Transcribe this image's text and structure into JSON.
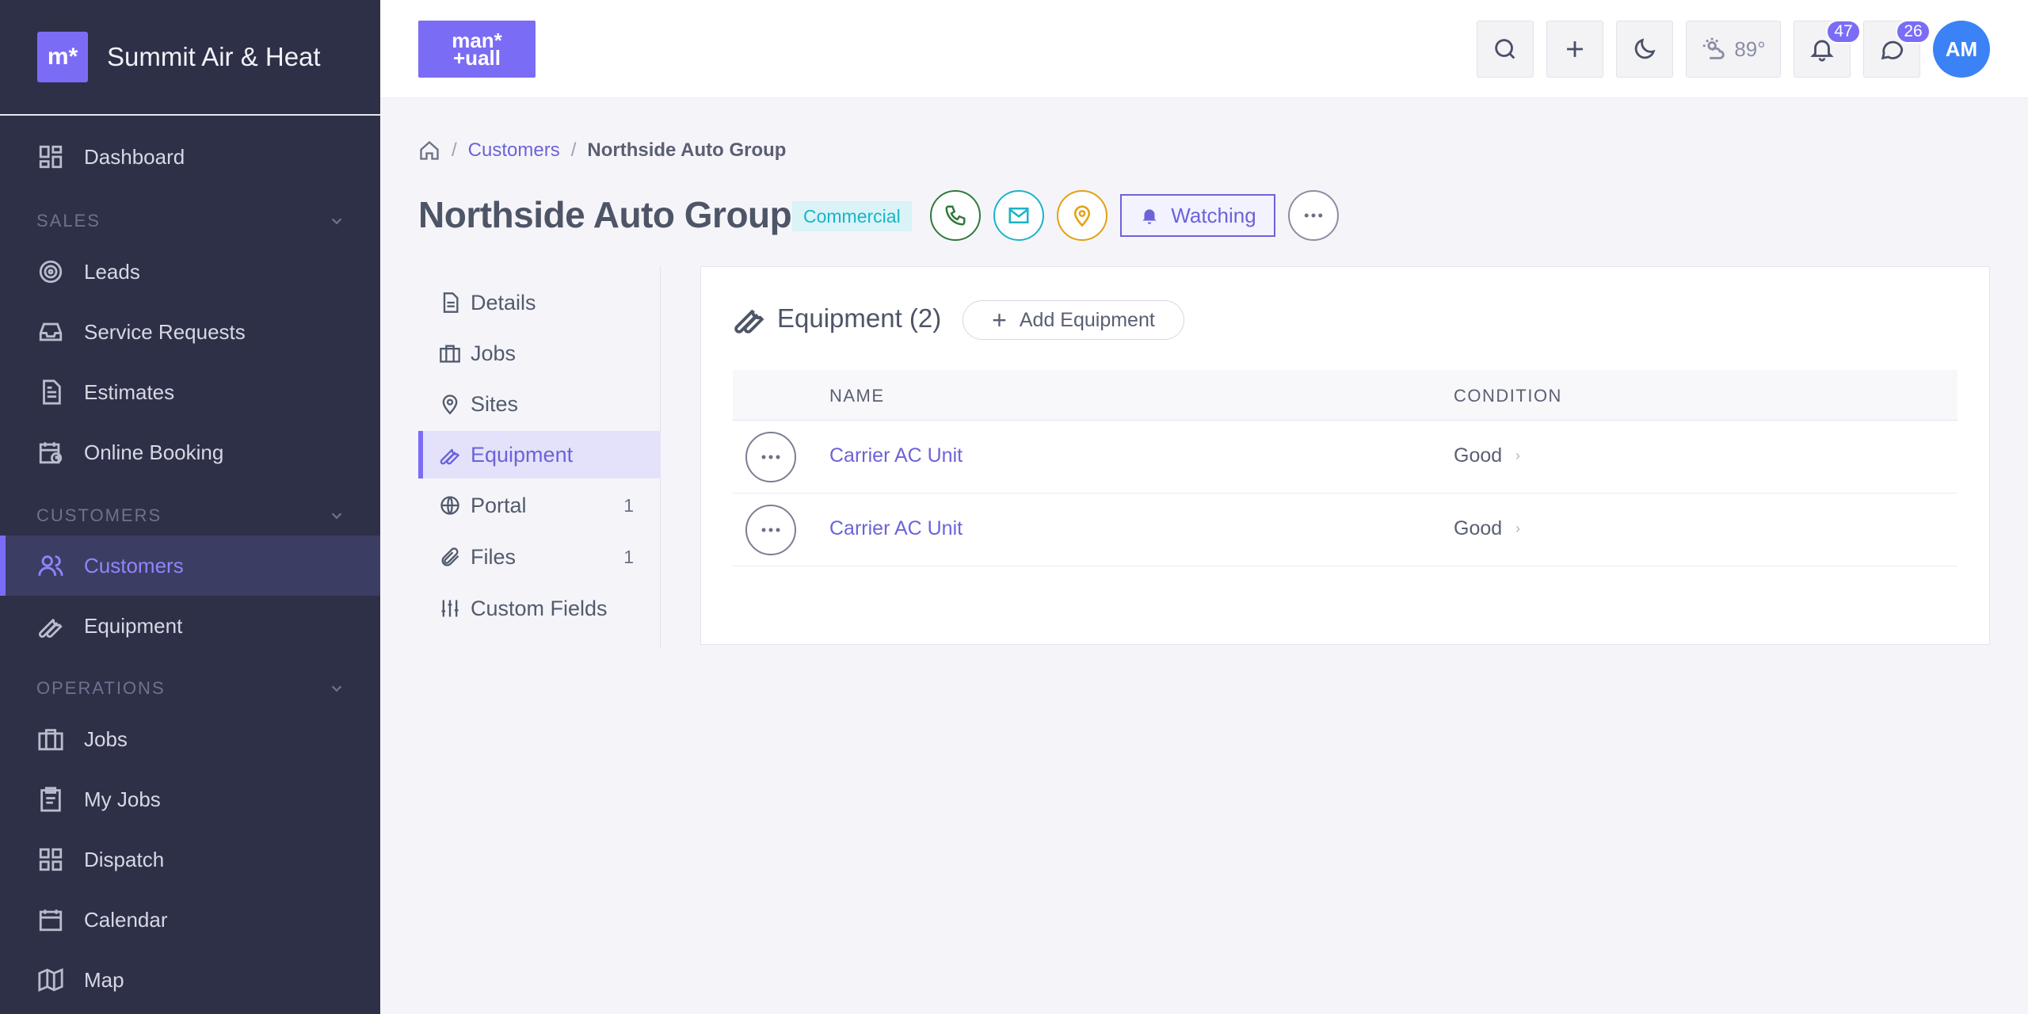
{
  "app": {
    "name": "Summit Air & Heat",
    "logo_text": "m*"
  },
  "top_logo_lines": [
    "man*",
    "+uall"
  ],
  "topbar": {
    "weather": "89°",
    "notifications_count": "47",
    "messages_count": "26",
    "avatar_initials": "AM"
  },
  "sidebar": {
    "dashboard": "Dashboard",
    "sections": [
      {
        "label": "SALES",
        "items": [
          "Leads",
          "Service Requests",
          "Estimates",
          "Online Booking"
        ]
      },
      {
        "label": "CUSTOMERS",
        "items": [
          "Customers",
          "Equipment"
        ]
      },
      {
        "label": "OPERATIONS",
        "items": [
          "Jobs",
          "My Jobs",
          "Dispatch",
          "Calendar",
          "Map"
        ]
      }
    ],
    "active": "Customers"
  },
  "breadcrumb": {
    "parent": "Customers",
    "current": "Northside Auto Group"
  },
  "customer": {
    "name": "Northside Auto Group",
    "tag": "Commercial",
    "watch_label": "Watching"
  },
  "colors": {
    "accent": "#7b6cf6",
    "phone": "#2f7a3a",
    "email": "#1ab4c8",
    "location": "#e5a00d"
  },
  "subnav": [
    {
      "label": "Details",
      "count": ""
    },
    {
      "label": "Jobs",
      "count": ""
    },
    {
      "label": "Sites",
      "count": ""
    },
    {
      "label": "Equipment",
      "count": "",
      "active": true
    },
    {
      "label": "Portal",
      "count": "1"
    },
    {
      "label": "Files",
      "count": "1"
    },
    {
      "label": "Custom Fields",
      "count": ""
    }
  ],
  "equipment": {
    "title": "Equipment (2)",
    "add_label": "Add Equipment",
    "columns": {
      "name": "NAME",
      "condition": "CONDITION"
    },
    "rows": [
      {
        "name": "Carrier AC Unit",
        "condition": "Good"
      },
      {
        "name": "Carrier AC Unit",
        "condition": "Good"
      }
    ]
  }
}
